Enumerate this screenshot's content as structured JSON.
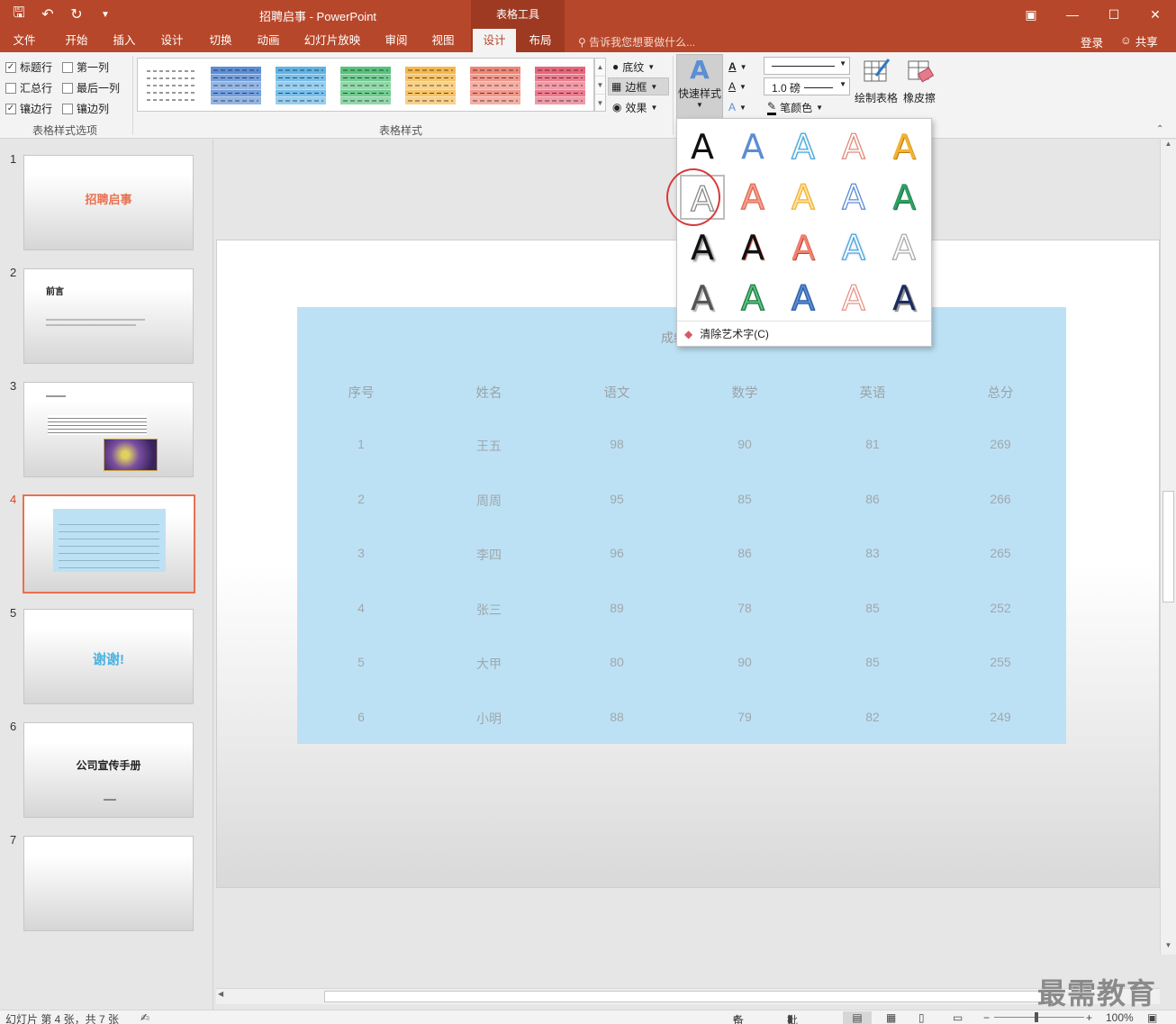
{
  "window": {
    "title": "招聘启事 - PowerPoint",
    "context_tab": "表格工具",
    "controls": [
      "restore-ribbon",
      "minimize",
      "maximize",
      "close"
    ]
  },
  "tabs": [
    {
      "label": "文件"
    },
    {
      "label": "开始"
    },
    {
      "label": "插入"
    },
    {
      "label": "设计"
    },
    {
      "label": "切换"
    },
    {
      "label": "动画"
    },
    {
      "label": "幻灯片放映"
    },
    {
      "label": "审阅"
    },
    {
      "label": "视图"
    },
    {
      "label": "设计",
      "active": true
    },
    {
      "label": "布局"
    }
  ],
  "tellme": "告诉我您想要做什么...",
  "login": "登录",
  "share": "共享",
  "options": {
    "header_row": "标题行",
    "first_col": "第一列",
    "total_row": "汇总行",
    "last_col": "最后一列",
    "banded_rows": "镶边行",
    "banded_cols": "镶边列",
    "group_label": "表格样式选项"
  },
  "styles": {
    "group_label": "表格样式",
    "shading": "底纹",
    "border": "边框",
    "effects": "效果",
    "colors": [
      "#ffffff",
      "#5b8ed6",
      "#5fb3e6",
      "#58c27d",
      "#f5b84d",
      "#ef8575",
      "#e8657a"
    ]
  },
  "wordart": {
    "quick_styles": "快速样式",
    "clear": "清除艺术字(C)"
  },
  "draw": {
    "weight": "1.0 磅",
    "pen_color": "笔颜色",
    "draw_table": "绘制表格",
    "eraser": "橡皮擦"
  },
  "slides": [
    {
      "num": "1",
      "title": "招聘启事"
    },
    {
      "num": "2",
      "title": "前言"
    },
    {
      "num": "3",
      "title": ""
    },
    {
      "num": "4",
      "title": ""
    },
    {
      "num": "5",
      "title": "谢谢!"
    },
    {
      "num": "6",
      "title": "公司宣传手册"
    },
    {
      "num": "7",
      "title": ""
    }
  ],
  "table": {
    "title": "成绩",
    "headers": [
      "序号",
      "姓名",
      "语文",
      "数学",
      "英语",
      "总分"
    ],
    "rows": [
      [
        "1",
        "王五",
        "98",
        "90",
        "81",
        "269"
      ],
      [
        "2",
        "周周",
        "95",
        "85",
        "86",
        "266"
      ],
      [
        "3",
        "李四",
        "96",
        "86",
        "83",
        "265"
      ],
      [
        "4",
        "张三",
        "89",
        "78",
        "85",
        "252"
      ],
      [
        "5",
        "大甲",
        "80",
        "90",
        "85",
        "255"
      ],
      [
        "6",
        "小明",
        "88",
        "79",
        "82",
        "249"
      ]
    ]
  },
  "status": {
    "slide_info": "幻灯片 第 4 张，共 7 张",
    "notes": "备注",
    "comments": "批注",
    "zoom": "100%"
  },
  "watermark": "最需教育"
}
